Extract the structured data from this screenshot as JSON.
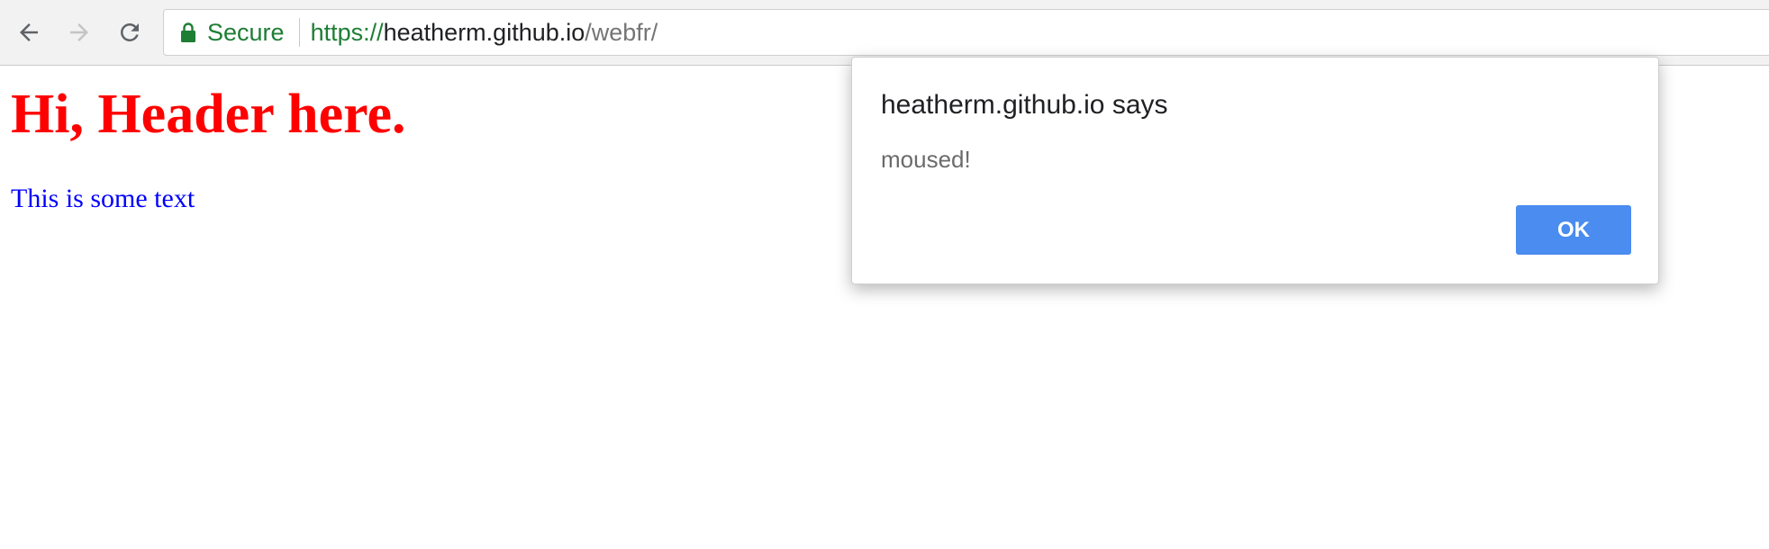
{
  "browser": {
    "nav": {
      "back_icon": "arrow-left-icon",
      "forward_icon": "arrow-right-icon",
      "reload_icon": "reload-icon"
    },
    "omnibox": {
      "lock_icon": "lock-icon",
      "secure_label": "Secure",
      "url_scheme": "https://",
      "url_host": "heatherm.github.io",
      "url_path": "/webfr/"
    },
    "colors": {
      "secure_green": "#1e7e34",
      "toolbar_bg": "#f2f2f2"
    }
  },
  "page": {
    "header": "Hi, Header here.",
    "text": "This is some text",
    "colors": {
      "header": "#ff0000",
      "text": "#0000ff"
    }
  },
  "alert": {
    "title": "heatherm.github.io says",
    "message": "moused!",
    "ok_label": "OK",
    "colors": {
      "ok_button": "#4a8cf0"
    }
  }
}
